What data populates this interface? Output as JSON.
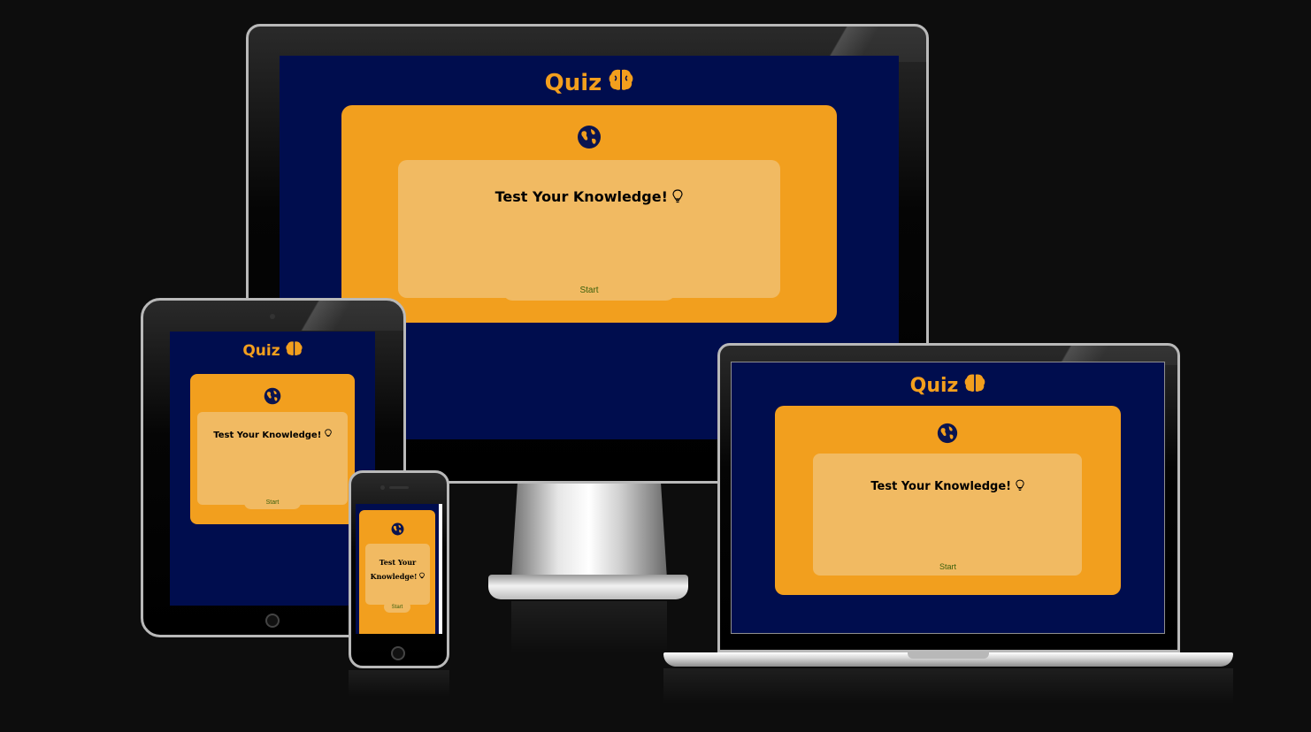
{
  "app": {
    "title": "Quiz",
    "title_icon": "brain-icon",
    "card_icon": "globe-icon",
    "heading": "Test Your Knowledge!",
    "heading_icon": "lightbulb-icon",
    "start_label": "Start"
  },
  "colors": {
    "page_background": "#0d0d0d",
    "screen_background": "#000d4e",
    "accent_orange": "#f29f1e",
    "inner_box": "#f1ba62",
    "start_text": "#3a5f0b"
  },
  "devices": [
    "desktop-monitor",
    "tablet",
    "phone",
    "laptop"
  ]
}
